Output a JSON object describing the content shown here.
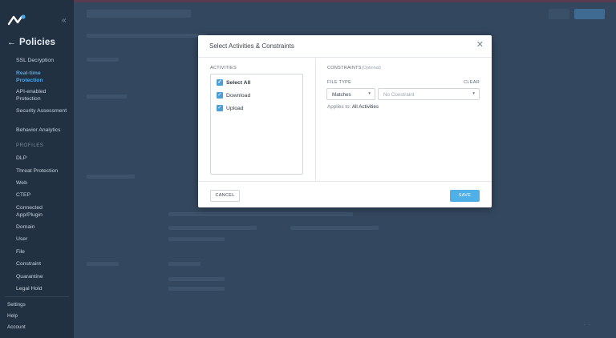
{
  "sidebar": {
    "back_title": "Policies",
    "items": [
      {
        "label": "SSL Decryption",
        "active": false
      },
      {
        "label": "Real-time Protection",
        "active": true
      },
      {
        "label": "API-enabled Protection",
        "active": false
      },
      {
        "label": "Security Assessment",
        "active": false
      },
      {
        "label": "Behavior Analytics",
        "active": false
      }
    ],
    "profiles_label": "PROFILES",
    "profiles": [
      "DLP",
      "Threat Protection",
      "Web",
      "CTEP",
      "Connected App/Plugin",
      "Domain",
      "User",
      "File",
      "Constraint",
      "Quarantine",
      "Legal Hold"
    ],
    "footer": [
      "Settings",
      "Help",
      "Account"
    ]
  },
  "modal": {
    "title": "Select Activities & Constraints",
    "activities_label": "ACTIVITIES",
    "activities": [
      {
        "label": "Select All",
        "checked": true
      },
      {
        "label": "Download",
        "checked": true
      },
      {
        "label": "Upload",
        "checked": true
      }
    ],
    "constraints_label": "CONSTRAINTS",
    "constraints_optional": "(Optional)",
    "file_type_label": "FILE TYPE",
    "clear_label": "CLEAR",
    "match_value": "Matches",
    "constraint_placeholder": "No Constraint",
    "applies_prefix": "Applies to:",
    "applies_value": "All Activities",
    "cancel_label": "CANCEL",
    "save_label": "SAVE"
  },
  "colors": {
    "accent": "#4eb0e6",
    "active_nav": "#4aa8e8",
    "sidebar_bg": "#223142",
    "overlay_bg": "#33475e"
  }
}
